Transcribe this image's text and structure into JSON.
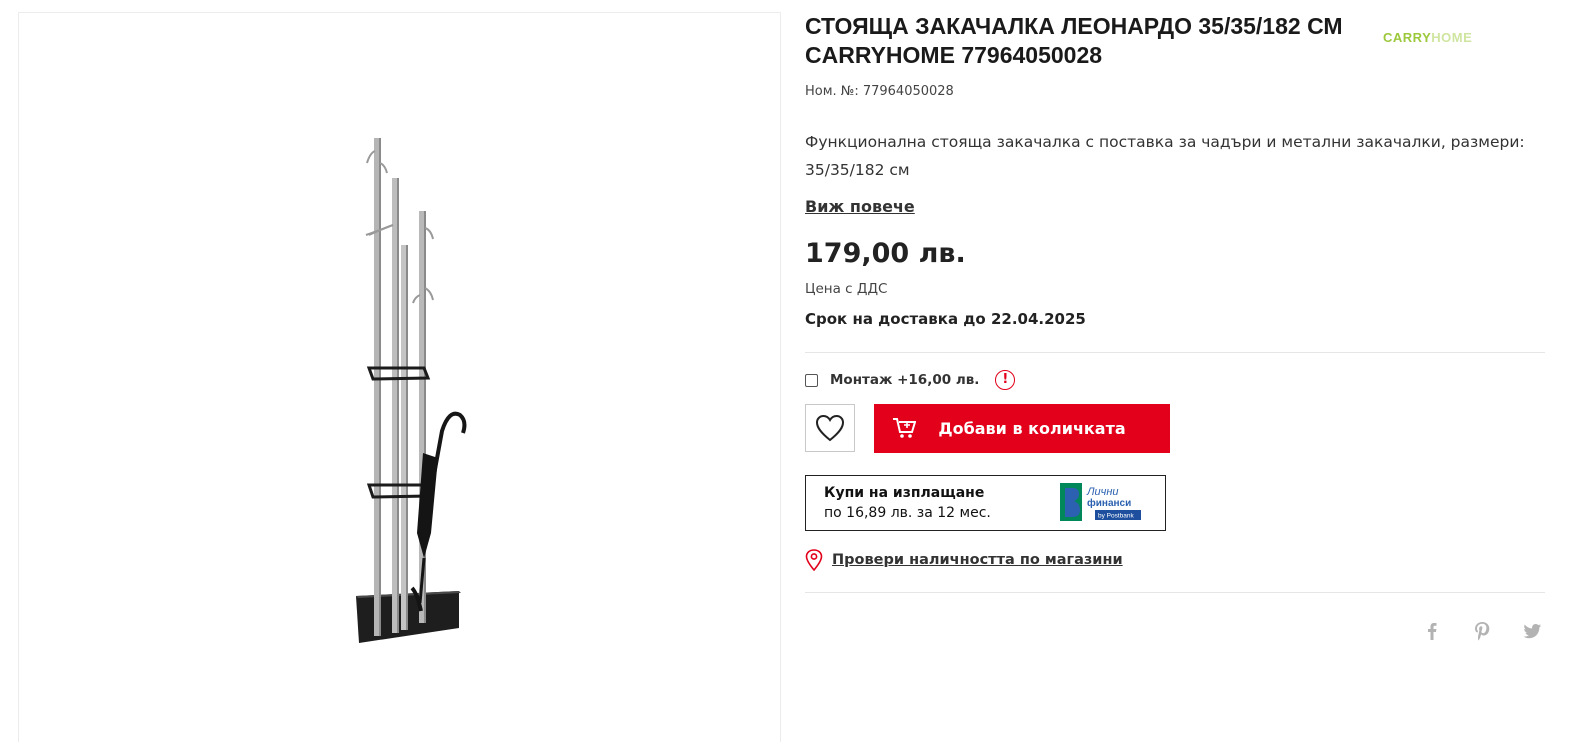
{
  "product": {
    "title": "СТОЯЩА ЗАКАЧАЛКА ЛЕОНАРДО 35/35/182 СМ CARRYHOME 77964050028",
    "brand_part1": "CARRY",
    "brand_part2": "HOME",
    "sku": "Ном. №: 77964050028",
    "description": "Функционална стояща закачалка с поставка за чадъри и метални закачалки, размери: 35/35/182 см",
    "see_more": "Виж повече",
    "price": "179,00 лв.",
    "vat_note": "Цена с ДДС",
    "delivery": "Срок на доставка до 22.04.2025"
  },
  "options": {
    "assembly_label": "Монтаж +16,00 лв.",
    "assembly_checked": false,
    "info_icon": "!"
  },
  "actions": {
    "wishlist_icon": "heart-icon",
    "add_to_cart": "Добави в количката",
    "cart_icon": "cart-icon"
  },
  "leasing": {
    "line1": "Купи на изплащане",
    "line2": "по 16,89 лв. за 12 мес.",
    "logo_text1": "Лични",
    "logo_text2": "финанси",
    "logo_text3": "by Postbank"
  },
  "availability": {
    "label": "Провери наличността по магазини",
    "icon": "location-pin-icon"
  },
  "share": [
    "facebook-icon",
    "pinterest-icon",
    "twitter-icon"
  ],
  "colors": {
    "accent": "#e2001a",
    "brand": "#9cc83c",
    "text": "#222222"
  }
}
